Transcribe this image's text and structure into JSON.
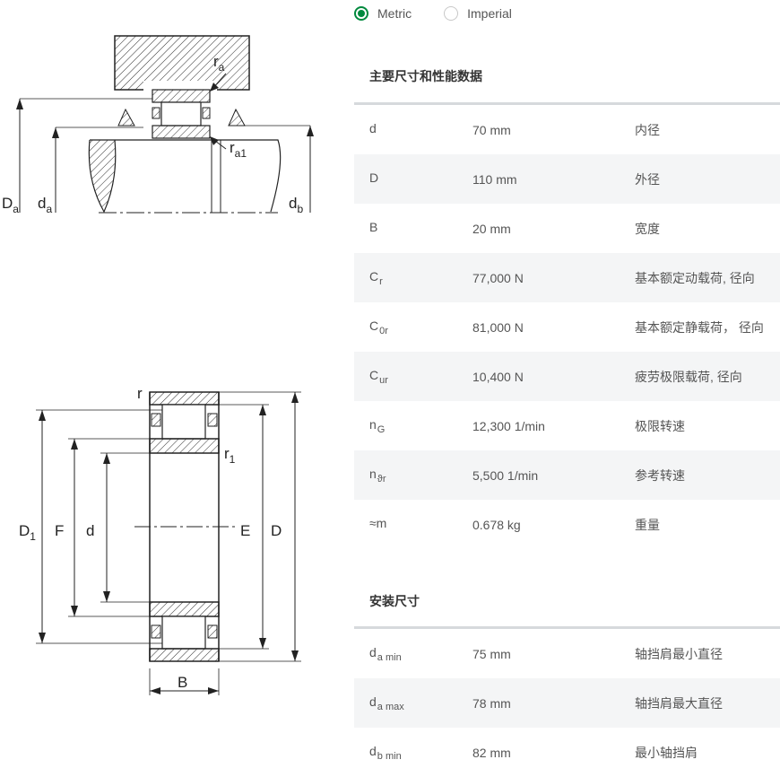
{
  "units": {
    "options": [
      {
        "label": "Metric",
        "selected": true
      },
      {
        "label": "Imperial",
        "selected": false
      }
    ]
  },
  "drawings": {
    "mounting_labels": {
      "ra": "r",
      "ra_sub": "a",
      "ra1": "r",
      "ra1_sub": "a1",
      "Da": "D",
      "Da_sub": "a",
      "da": "d",
      "da_sub": "a",
      "db": "d",
      "db_sub": "b"
    },
    "bearing_labels": {
      "r": "r",
      "r1": "r",
      "r1_sub": "1",
      "D1": "D",
      "D1_sub": "1",
      "F": "F",
      "d": "d",
      "E": "E",
      "D": "D",
      "B": "B"
    }
  },
  "dimensions": {
    "title": "主要尺寸和性能数据",
    "rows": [
      {
        "symbol": "d",
        "sub": "",
        "value": "70 mm",
        "desc": "内径"
      },
      {
        "symbol": "D",
        "sub": "",
        "value": "110 mm",
        "desc": "外径"
      },
      {
        "symbol": "B",
        "sub": "",
        "value": "20 mm",
        "desc": "宽度"
      },
      {
        "symbol": "C",
        "sub": "r",
        "value": "77,000 N",
        "desc": "基本额定动载荷, 径向"
      },
      {
        "symbol": "C",
        "sub": "0r",
        "value": "81,000 N",
        "desc": "基本额定静载荷， 径向"
      },
      {
        "symbol": "C",
        "sub": "ur",
        "value": "10,400 N",
        "desc": "疲劳极限载荷, 径向"
      },
      {
        "symbol": "n",
        "sub": "G",
        "value": "12,300 1/min",
        "desc": "极限转速"
      },
      {
        "symbol": "n",
        "sub": "ϑr",
        "value": "5,500 1/min",
        "desc": "参考转速"
      },
      {
        "symbol": "≈m",
        "sub": "",
        "value": "0.678 kg",
        "desc": "重量"
      }
    ]
  },
  "mounting": {
    "title": "安装尺寸",
    "rows": [
      {
        "symbol": "d",
        "sub": "a min",
        "value": "75 mm",
        "desc": "轴挡肩最小直径"
      },
      {
        "symbol": "d",
        "sub": "a max",
        "value": "78 mm",
        "desc": "轴挡肩最大直径"
      },
      {
        "symbol": "d",
        "sub": "b min",
        "value": "82 mm",
        "desc": "最小轴挡肩"
      }
    ]
  }
}
